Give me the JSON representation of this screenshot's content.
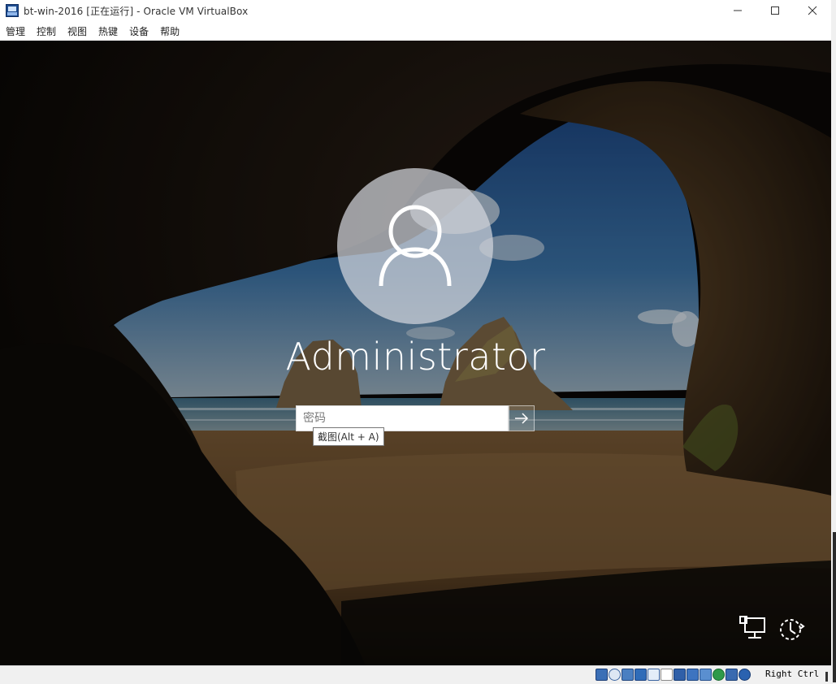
{
  "window": {
    "title": "bt-win-2016 [正在运行] - Oracle VM VirtualBox",
    "minimize_icon": "minimize-icon",
    "maximize_icon": "maximize-icon",
    "close_icon": "close-icon"
  },
  "menu": {
    "items": [
      "管理",
      "控制",
      "视图",
      "热键",
      "设备",
      "帮助"
    ]
  },
  "login": {
    "username": "Administrator",
    "password_placeholder": "密码",
    "password_value": "",
    "submit_icon": "arrow-right-icon",
    "tooltip": "截图(Alt + A)",
    "network_icon": "network-icon",
    "power_icon": "power-icon",
    "avatar_icon": "user-avatar-icon"
  },
  "statusbar": {
    "icons": [
      "hard-disk-icon",
      "optical-drive-icon",
      "audio-icon",
      "network-adapter-icon",
      "usb-icon",
      "shared-folders-icon",
      "display-icon",
      "video-capture-icon",
      "mouse-integration-icon",
      "virtualization-icon",
      "guest-additions-icon",
      "download-icon"
    ],
    "host_key": "Right Ctrl"
  },
  "colors": {
    "title_bg": "#ffffff",
    "status_bg": "#f0f0f0",
    "avatar_fill": "#d2d6dc",
    "text_white": "#ffffff"
  }
}
